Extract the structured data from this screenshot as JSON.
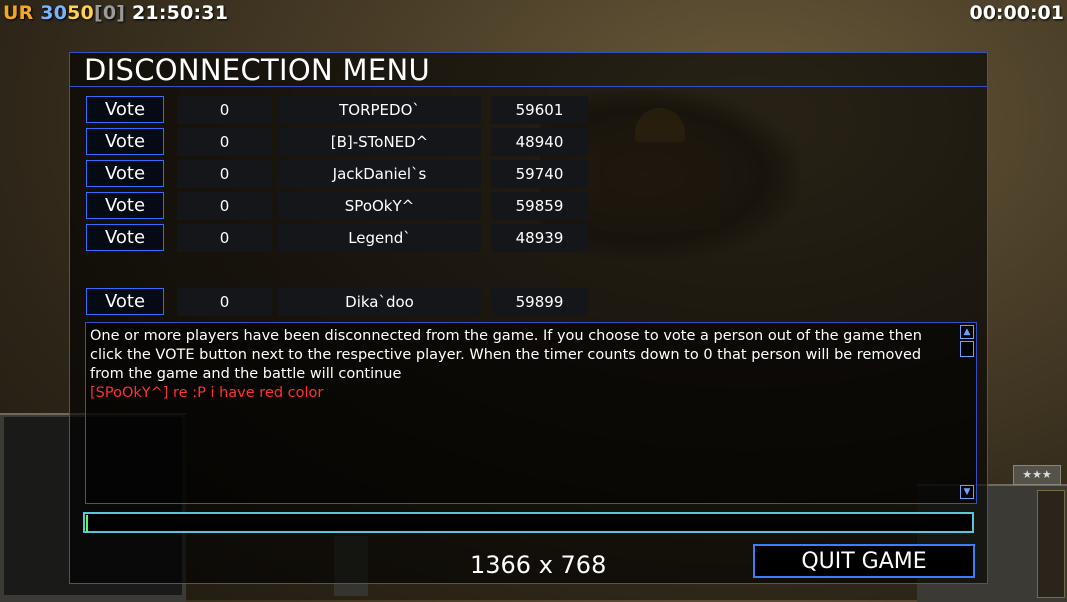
{
  "hud": {
    "faction": "UR",
    "value_a": "30",
    "value_b": "50",
    "bracket_open": "[",
    "bracket_value": "0",
    "bracket_close": "]",
    "clock": "21:50:31",
    "timer": "00:00:01"
  },
  "dialog": {
    "title": "DISCONNECTION MENU",
    "vote_label": "Vote",
    "players": [
      {
        "votes": "0",
        "name": "TORPEDO`",
        "ping": "59601"
      },
      {
        "votes": "0",
        "name": "[B]-SToNED^",
        "ping": "48940"
      },
      {
        "votes": "0",
        "name": "JackDaniel`s",
        "ping": "59740"
      },
      {
        "votes": "0",
        "name": "SPoOkY^",
        "ping": "59859"
      },
      {
        "votes": "0",
        "name": "Legend`",
        "ping": "48939"
      },
      {
        "votes": "0",
        "name": "Dika`doo",
        "ping": "59899"
      }
    ],
    "message": "One or more players have been disconnected from the game. If you choose to vote a person out of the game then click the VOTE button next to the respective player. When the timer counts down to 0 that person will be removed from the game and the battle will continue",
    "chat_line": "[SPoOkY^] re :P i have red color",
    "chat_input_value": "",
    "resolution": "1366 x 768",
    "quit_label": "QUIT GAME"
  },
  "hud_bottom": {
    "rank_label": "★★★"
  }
}
